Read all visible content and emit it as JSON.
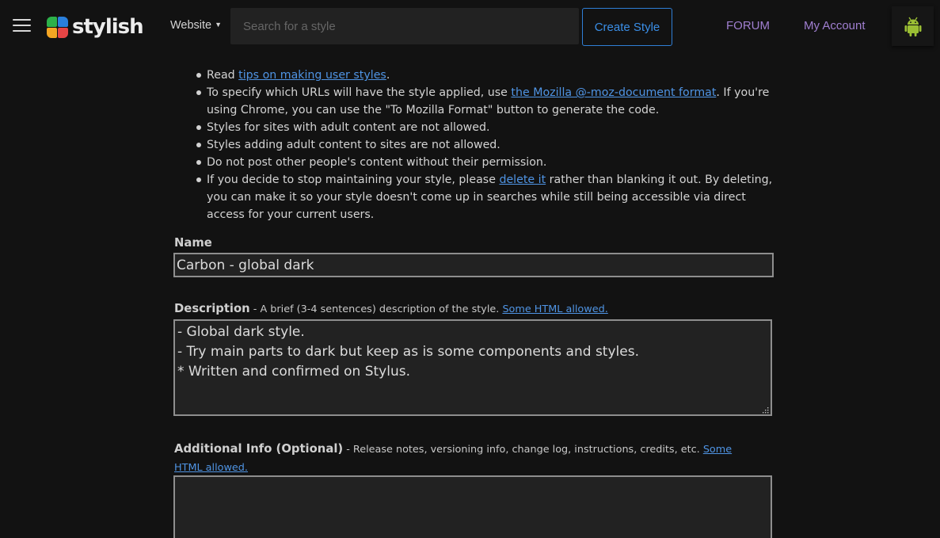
{
  "header": {
    "logo_text": "stylish",
    "site_select": "Website",
    "search_placeholder": "Search for a style",
    "create_button": "Create Style",
    "nav": {
      "forum": "FORUM",
      "account": "My Account"
    },
    "colors": {
      "accent": "#2f7fd6",
      "nav_link": "#a07fd0",
      "android": "#9bbf34"
    }
  },
  "rules": [
    {
      "segments": [
        {
          "t": "Read "
        },
        {
          "t": "tips on making user styles",
          "link": true
        },
        {
          "t": "."
        }
      ]
    },
    {
      "segments": [
        {
          "t": "To specify which URLs will have the style applied, use "
        },
        {
          "t": "the Mozilla @-moz-document format",
          "link": true
        },
        {
          "t": ". If you're using Chrome, you can use the \"To Mozilla Format\" button to generate the code."
        }
      ]
    },
    {
      "segments": [
        {
          "t": "Styles for sites with adult content are not allowed."
        }
      ]
    },
    {
      "segments": [
        {
          "t": "Styles adding adult content to sites are not allowed."
        }
      ]
    },
    {
      "segments": [
        {
          "t": "Do not post other people's content without their permission."
        }
      ]
    },
    {
      "segments": [
        {
          "t": "If you decide to stop maintaining your style, please "
        },
        {
          "t": "delete it",
          "link": true
        },
        {
          "t": " rather than blanking it out. By deleting, you can make it so your style doesn't come up in searches while still being accessible via direct access for your current users."
        }
      ]
    }
  ],
  "form": {
    "name_label": "Name",
    "name_value": "Carbon - global dark",
    "description_label": "Description",
    "description_hint": " - A brief (3-4 sentences) description of the style. ",
    "description_link": "Some HTML allowed.",
    "description_value": "- Global dark style.\n- Try main parts to dark but keep as is some components and styles.\n* Written and confirmed on Stylus.",
    "additional_label": "Additional Info (Optional)",
    "additional_hint": " - Release notes, versioning info, change log, instructions, credits, etc. ",
    "additional_link": "Some HTML allowed.",
    "additional_value": ""
  }
}
